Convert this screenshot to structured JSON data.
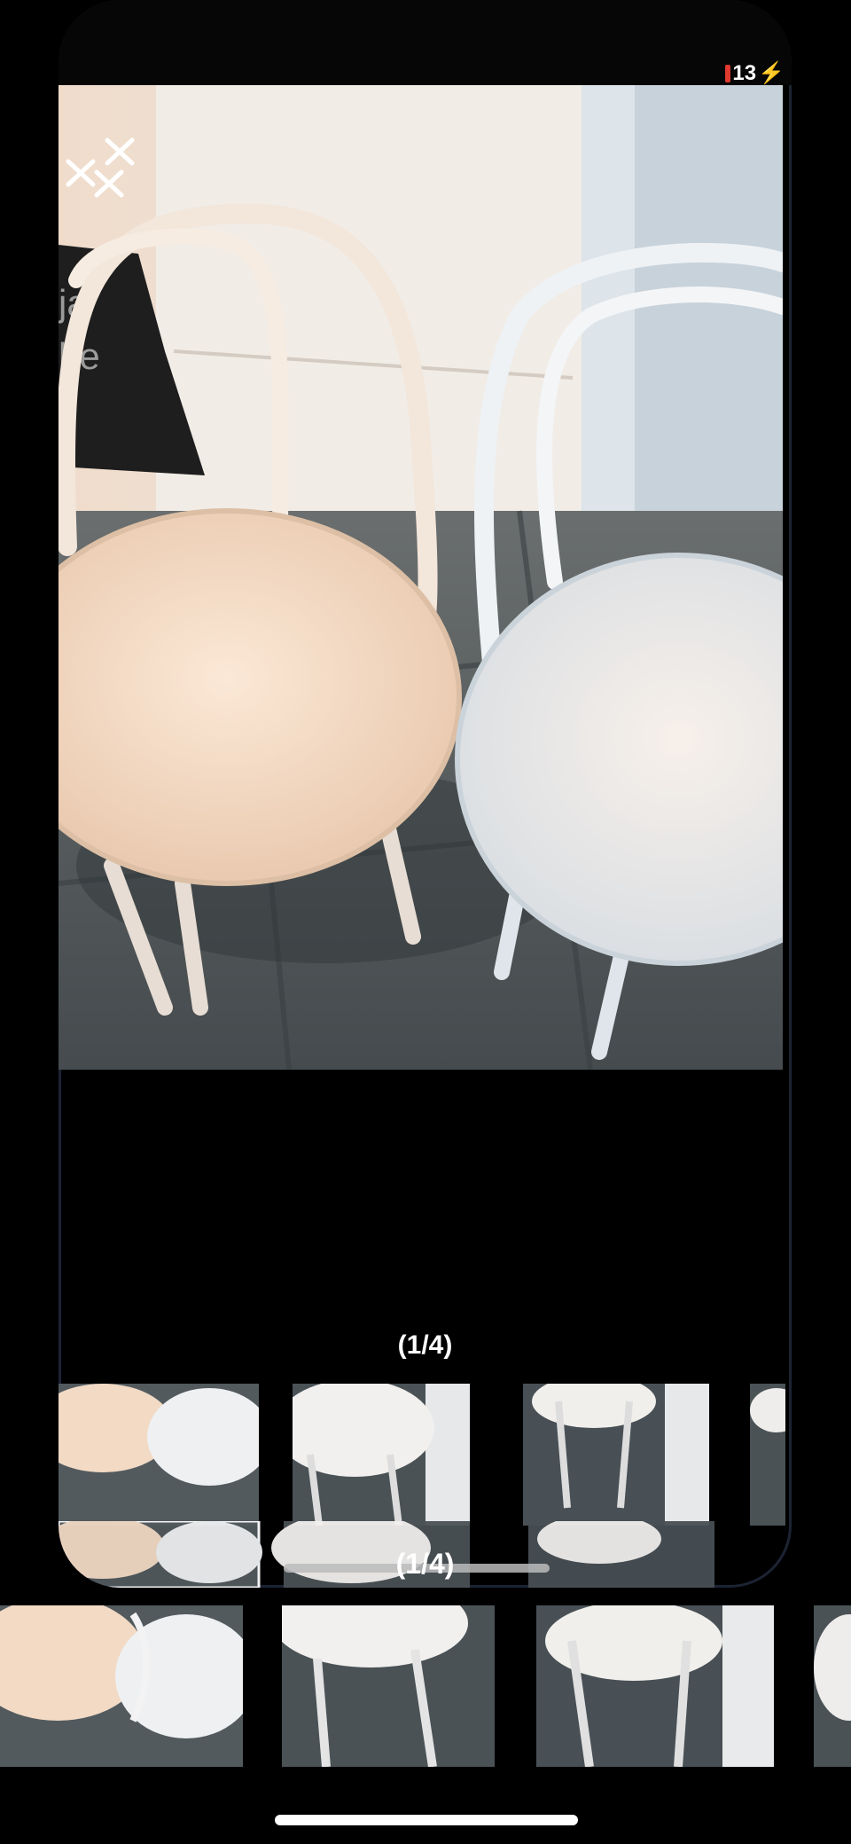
{
  "viewer": {
    "counter": "(1/4)",
    "ghost_counter": "(1/4)",
    "battery": "13",
    "current_index": 1,
    "total": 4,
    "close_icon": "close-icon"
  },
  "thumbnails": [
    {
      "name": "thumbnail-1",
      "selected": true
    },
    {
      "name": "thumbnail-2",
      "selected": false
    },
    {
      "name": "thumbnail-3",
      "selected": false
    },
    {
      "name": "thumbnail-4",
      "selected": false
    }
  ],
  "colors": {
    "background": "#000000",
    "seat_warm": "#f3dcc6",
    "seat_cool": "#e9eef2",
    "floor": "#4e5559",
    "wall": "#e9e3db"
  }
}
